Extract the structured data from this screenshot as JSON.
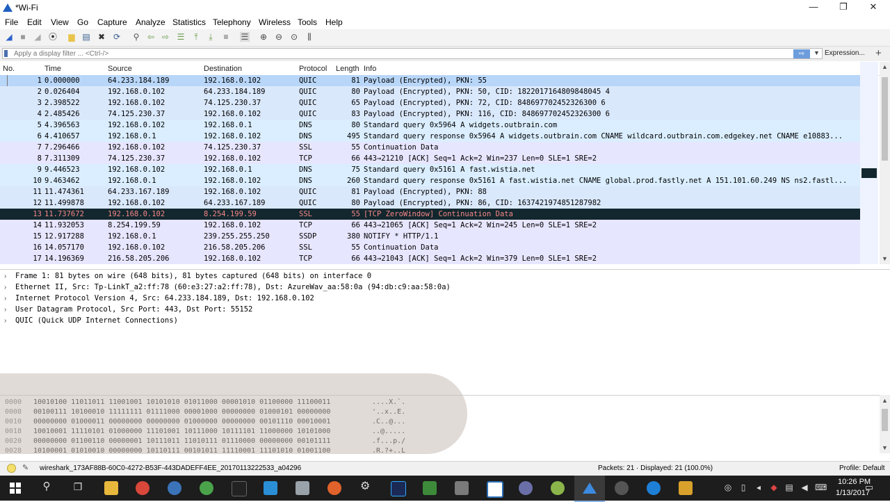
{
  "window": {
    "title": "*Wi-Fi",
    "minimize": "—",
    "restore": "❐",
    "close": "✕"
  },
  "menu": [
    "File",
    "Edit",
    "View",
    "Go",
    "Capture",
    "Analyze",
    "Statistics",
    "Telephony",
    "Wireless",
    "Tools",
    "Help"
  ],
  "filter": {
    "placeholder": "Apply a display filter ... <Ctrl-/>",
    "apply": "⇨",
    "expression": "Expression...",
    "add": "+"
  },
  "columns": {
    "no": "No.",
    "time": "Time",
    "source": "Source",
    "destination": "Destination",
    "protocol": "Protocol",
    "length": "Length",
    "info": "Info"
  },
  "packets": [
    {
      "no": "1",
      "time": "0.000000",
      "src": "64.233.184.189",
      "dst": "192.168.0.102",
      "proto": "QUIC",
      "len": "81",
      "info": "Payload (Encrypted), PKN: 55"
    },
    {
      "no": "2",
      "time": "0.026404",
      "src": "192.168.0.102",
      "dst": "64.233.184.189",
      "proto": "QUIC",
      "len": "80",
      "info": "Payload (Encrypted), PKN: 50, CID: 1822017164809848045 4"
    },
    {
      "no": "3",
      "time": "2.398522",
      "src": "192.168.0.102",
      "dst": "74.125.230.37",
      "proto": "QUIC",
      "len": "65",
      "info": "Payload (Encrypted), PKN: 72, CID: 848697702452326300 6"
    },
    {
      "no": "4",
      "time": "2.485426",
      "src": "74.125.230.37",
      "dst": "192.168.0.102",
      "proto": "QUIC",
      "len": "83",
      "info": "Payload (Encrypted), PKN: 116, CID: 848697702452326300 6"
    },
    {
      "no": "5",
      "time": "4.396563",
      "src": "192.168.0.102",
      "dst": "192.168.0.1",
      "proto": "DNS",
      "len": "80",
      "info": "Standard query 0x5964 A widgets.outbrain.com"
    },
    {
      "no": "6",
      "time": "4.410657",
      "src": "192.168.0.1",
      "dst": "192.168.0.102",
      "proto": "DNS",
      "len": "495",
      "info": "Standard query response 0x5964 A widgets.outbrain.com CNAME wildcard.outbrain.com.edgekey.net CNAME e10883..."
    },
    {
      "no": "7",
      "time": "7.296466",
      "src": "192.168.0.102",
      "dst": "74.125.230.37",
      "proto": "SSL",
      "len": "55",
      "info": "Continuation Data"
    },
    {
      "no": "8",
      "time": "7.311309",
      "src": "74.125.230.37",
      "dst": "192.168.0.102",
      "proto": "TCP",
      "len": "66",
      "info": "443→21210 [ACK] Seq=1 Ack=2 Win=237 Len=0 SLE=1 SRE=2"
    },
    {
      "no": "9",
      "time": "9.446523",
      "src": "192.168.0.102",
      "dst": "192.168.0.1",
      "proto": "DNS",
      "len": "75",
      "info": "Standard query 0x5161 A fast.wistia.net"
    },
    {
      "no": "10",
      "time": "9.463462",
      "src": "192.168.0.1",
      "dst": "192.168.0.102",
      "proto": "DNS",
      "len": "260",
      "info": "Standard query response 0x5161 A fast.wistia.net CNAME global.prod.fastly.net A 151.101.60.249 NS ns2.fastl..."
    },
    {
      "no": "11",
      "time": "11.474361",
      "src": "64.233.167.189",
      "dst": "192.168.0.102",
      "proto": "QUIC",
      "len": "81",
      "info": "Payload (Encrypted), PKN: 88"
    },
    {
      "no": "12",
      "time": "11.499878",
      "src": "192.168.0.102",
      "dst": "64.233.167.189",
      "proto": "QUIC",
      "len": "80",
      "info": "Payload (Encrypted), PKN: 86, CID: 1637421974851287982"
    },
    {
      "no": "13",
      "time": "11.737672",
      "src": "192.168.0.102",
      "dst": "8.254.199.59",
      "proto": "SSL",
      "len": "55",
      "info": "[TCP ZeroWindow] Continuation Data"
    },
    {
      "no": "14",
      "time": "11.932053",
      "src": "8.254.199.59",
      "dst": "192.168.0.102",
      "proto": "TCP",
      "len": "66",
      "info": "443→21065 [ACK] Seq=1 Ack=2 Win=245 Len=0 SLE=1 SRE=2"
    },
    {
      "no": "15",
      "time": "12.917288",
      "src": "192.168.0.1",
      "dst": "239.255.255.250",
      "proto": "SSDP",
      "len": "380",
      "info": "NOTIFY * HTTP/1.1"
    },
    {
      "no": "16",
      "time": "14.057170",
      "src": "192.168.0.102",
      "dst": "216.58.205.206",
      "proto": "SSL",
      "len": "55",
      "info": "Continuation Data"
    },
    {
      "no": "17",
      "time": "14.196369",
      "src": "216.58.205.206",
      "dst": "192.168.0.102",
      "proto": "TCP",
      "len": "66",
      "info": "443→21043 [ACK] Seq=1 Ack=2 Win=379 Len=0 SLE=1 SRE=2"
    }
  ],
  "row_colors": {
    "quic": "#dae8fc",
    "dns": "#daeeff",
    "ssl": "#e7e6ff",
    "tcp": "#e7e6ff",
    "ssdp": "#e7e6ff",
    "selected": "#b8d6f8",
    "zerowindow_bg": "#12272e",
    "zerowindow_fg": "#f78787"
  },
  "details": [
    "Frame 1: 81 bytes on wire (648 bits), 81 bytes captured (648 bits) on interface 0",
    "Ethernet II, Src: Tp-LinkT_a2:ff:78 (60:e3:27:a2:ff:78), Dst: AzureWav_aa:58:0a (94:db:c9:aa:58:0a)",
    "Internet Protocol Version 4, Src: 64.233.184.189, Dst: 192.168.0.102",
    "User Datagram Protocol, Src Port: 443, Dst Port: 55152",
    "QUIC (Quick UDP Internet Connections)"
  ],
  "bytes": [
    {
      "off": "0000",
      "bits": "10010100 11011011 11001001 10101010 01011000 00001010 01100000 11100011",
      "ascii": "....X.`."
    },
    {
      "off": "0008",
      "bits": "00100111 10100010 11111111 01111000 00001000 00000000 01000101 00000000",
      "ascii": "'..x..E."
    },
    {
      "off": "0010",
      "bits": "00000000 01000011 00000000 00000000 01000000 00000000 00101110 00010001",
      "ascii": ".C..@..."
    },
    {
      "off": "0018",
      "bits": "10010001 11110101 01000000 11101001 10111000 10111101 11000000 10101000",
      "ascii": "..@....."
    },
    {
      "off": "0020",
      "bits": "00000000 01100110 00000001 10111011 11010111 01110000 00000000 00101111",
      "ascii": ".f...p./"
    },
    {
      "off": "0028",
      "bits": "10100001 01010010 00000000 10110111 00101011 11110001 11101010 01001100",
      "ascii": ".R.?+..L"
    }
  ],
  "status": {
    "file": "wireshark_173AF88B-60C0-4272-B53F-443DADEFF4EE_20170113222533_a04296",
    "packets": "Packets: 21 · Displayed: 21 (100.0%)",
    "profile": "Profile: Default"
  },
  "clock": {
    "time": "10:26 PM",
    "date": "1/13/2017"
  }
}
